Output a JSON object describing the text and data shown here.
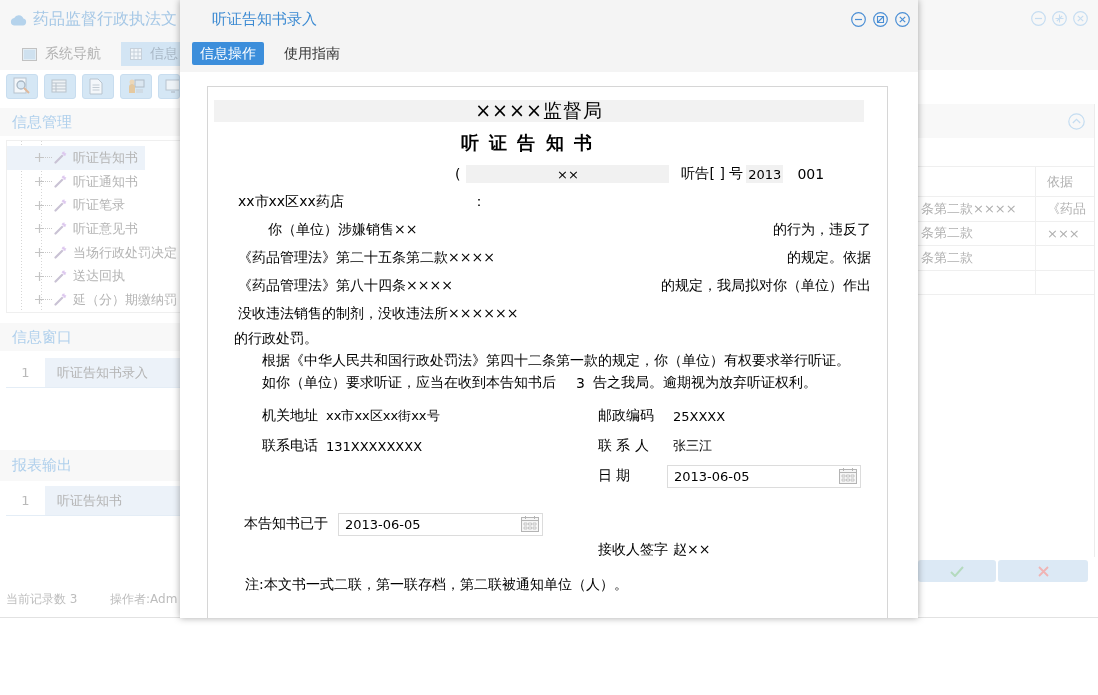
{
  "app": {
    "title": "药品监督行政执法文",
    "nav": [
      {
        "label": "系统导航",
        "selected": false
      },
      {
        "label": "信息",
        "selected": true
      }
    ]
  },
  "info_management": {
    "title": "信息管理",
    "tree": [
      {
        "label": "听证告知书",
        "selected": true,
        "expanded": false
      },
      {
        "label": "听证通知书",
        "selected": false,
        "expanded": false
      },
      {
        "label": "听证笔录",
        "selected": false,
        "expanded": false
      },
      {
        "label": "听证意见书",
        "selected": false,
        "expanded": false
      },
      {
        "label": "当场行政处罚决定",
        "selected": false,
        "expanded": false
      },
      {
        "label": "送达回执",
        "selected": false,
        "expanded": false
      },
      {
        "label": "延（分）期缴纳罚",
        "selected": false,
        "expanded": false
      }
    ]
  },
  "info_window": {
    "title": "信息窗口",
    "rows": [
      {
        "index": "1",
        "label": "听证告知书录入",
        "selected": true
      }
    ]
  },
  "report_output": {
    "title": "报表输出",
    "rows": [
      {
        "index": "1",
        "label": "听证告知书",
        "selected": true
      }
    ]
  },
  "status_bar": {
    "record_count": "当前记录数 3",
    "operator": "操作者:Adm"
  },
  "record_table": {
    "column_2": "依据",
    "rows": [
      {
        "column_1": "条第二款××××",
        "column_2": "《药品"
      },
      {
        "column_1": "条第二款",
        "column_2": "×××"
      },
      {
        "column_1": "条第二款"
      }
    ]
  },
  "dialog": {
    "title": "听证告知书录入",
    "tabs": [
      {
        "label": "信息操作",
        "selected": true
      },
      {
        "label": "使用指南",
        "selected": false
      }
    ],
    "document": {
      "agency": "××××监督局",
      "title": "听 证 告 知 书",
      "number": {
        "open": "(",
        "agency_code": "××",
        "label": "听告[ ] 号",
        "year": "2013",
        "serial": "001"
      },
      "addressee": "xx市xx区xx药店",
      "addressee_colon": "：",
      "clauses": [
        {
          "kind": "indented",
          "text": "你（单位）涉嫌销售××",
          "tail": "的行为，违反了"
        },
        {
          "kind": "flush",
          "text": "《药品管理法》第二十五条第二款××××",
          "tail": "的规定。依据"
        },
        {
          "kind": "flush",
          "text": "《药品管理法》第八十四条××××",
          "tail": "的规定，我局拟对你（单位）作出"
        },
        {
          "kind": "flush",
          "text": "没收违法销售的制剂，没收违法所××××××"
        }
      ],
      "penalty_end": "的行政处罚。",
      "rights": "根据《中华人民共和国行政处罚法》第四十二条第一款的规定，你（单位）有权要求举行听证。",
      "deadline": {
        "text": "如你（单位）要求听证，应当在收到本告知书后",
        "days": "3",
        "tail": "告之我局。逾期视为放弃听证权利。"
      },
      "contacts": [
        {
          "label": "机关地址",
          "value": "xx市xx区xx街xx号"
        },
        {
          "label": "邮政编码",
          "value": "25XXXX"
        },
        {
          "label": "联系电话",
          "value": "131XXXXXXXX"
        },
        {
          "label": "联 系 人",
          "value": "张三江"
        }
      ],
      "date": {
        "label": "日 期",
        "value": "2013-06-05"
      },
      "served": {
        "label": "本告知书已于",
        "value": "2013-06-05"
      },
      "signature": {
        "label": "接收人签字",
        "value": "赵××"
      },
      "note": "注:本文书一式二联，第一联存档，第二联被通知单位（人）。"
    }
  }
}
